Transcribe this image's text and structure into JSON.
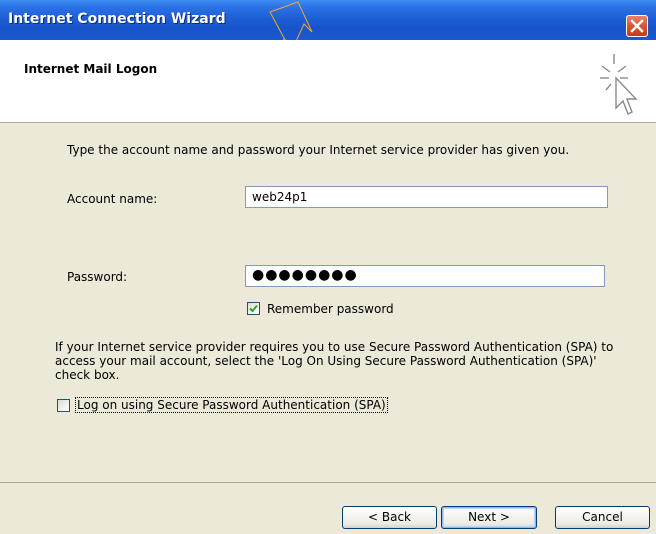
{
  "window": {
    "title": "Internet Connection Wizard"
  },
  "header": {
    "title": "Internet Mail Logon"
  },
  "body": {
    "instruction": "Type the account name and password your Internet service provider has given you.",
    "account_name_label": "Account name:",
    "account_name_value": "web24p1",
    "password_label": "Password:",
    "password_value": "●●●●●●●●",
    "remember_password_label": "Remember password",
    "remember_password_checked": true,
    "spa_description": "If your Internet service provider requires you to use Secure Password Authentication (SPA) to access your mail account, select the 'Log On Using Secure Password Authentication (SPA)' check box.",
    "spa_checkbox_label": "Log on using Secure Password Authentication (SPA)",
    "spa_checked": false
  },
  "buttons": {
    "back": "< Back",
    "next": "Next >",
    "cancel": "Cancel"
  },
  "icons": {
    "close": "close-icon",
    "wizard": "wizard-cursor-icon",
    "check": "check-icon"
  },
  "colors": {
    "titlebar": "#1e5fd6",
    "close_button": "#d6512f",
    "dialog_bg": "#ece9d8",
    "check": "#21a121",
    "watermark": "#f5a623"
  }
}
